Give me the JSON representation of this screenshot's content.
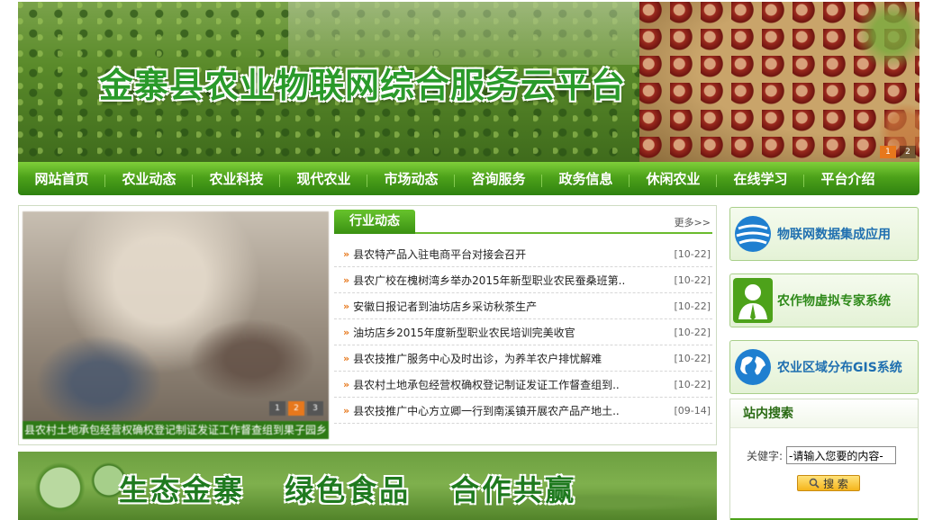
{
  "banner": {
    "title": "金寨县农业物联网综合服务云平台",
    "slides": [
      "1",
      "2"
    ]
  },
  "nav": {
    "items": [
      "网站首页",
      "农业动态",
      "农业科技",
      "现代农业",
      "市场动态",
      "咨询服务",
      "政务信息",
      "休闲农业",
      "在线学习",
      "平台介绍"
    ]
  },
  "slideshow": {
    "caption": "县农村土地承包经营权确权登记制证发证工作督查组到果子园乡",
    "pages": [
      "1",
      "2",
      "3"
    ]
  },
  "news": {
    "heading": "行业动态",
    "more": "更多>>",
    "items": [
      {
        "title": "县农特产品入驻电商平台对接会召开",
        "date": "[10-22]"
      },
      {
        "title": "县农广校在槐树湾乡举办2015年新型职业农民蚕桑班第..",
        "date": "[10-22]"
      },
      {
        "title": "安徽日报记者到油坊店乡采访秋茶生产",
        "date": "[10-22]"
      },
      {
        "title": "油坊店乡2015年度新型职业农民培训完美收官",
        "date": "[10-22]"
      },
      {
        "title": "县农技推广服务中心及时出诊，为养羊农户排忧解难",
        "date": "[10-22]"
      },
      {
        "title": "县农村土地承包经营权确权登记制证发证工作督查组到..",
        "date": "[10-22]"
      },
      {
        "title": "县农技推广中心方立卿一行到南溪镇开展农产品产地土..",
        "date": "[09-14]"
      }
    ]
  },
  "slogan": {
    "text": "生态金寨 绿色食品 合作共赢"
  },
  "systems": [
    {
      "label": "物联网数据集成应用",
      "icon": "globe-icon"
    },
    {
      "label": "农作物虚拟专家系统",
      "icon": "expert-person-icon"
    },
    {
      "label": "农业区域分布GIS系统",
      "icon": "world-map-icon"
    }
  ],
  "search": {
    "heading": "站内搜索",
    "keyword_label": "关健字:",
    "input_value": "-请输入您要的内容-",
    "button_label": "搜 索"
  },
  "colors": {
    "nav_green": "#4da21a",
    "accent_orange": "#e7781c",
    "title_green": "#2a9a2a",
    "system_blue": "#1f6fb0"
  }
}
